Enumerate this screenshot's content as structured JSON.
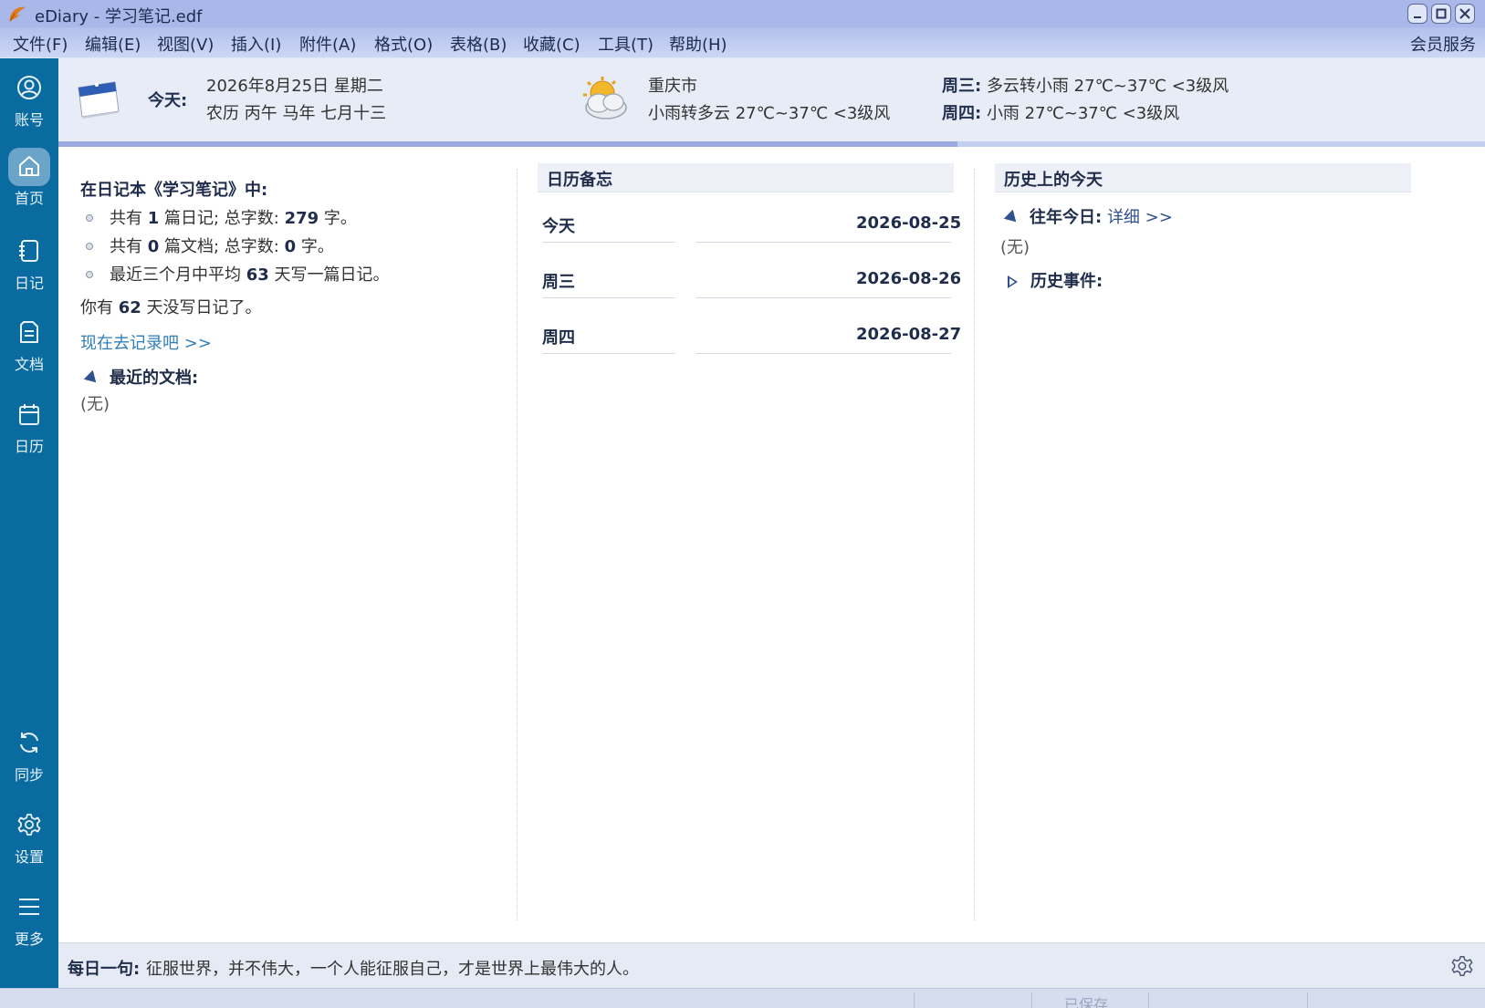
{
  "window": {
    "title": "eDiary - 学习笔记.edf",
    "member_service": "会员服务"
  },
  "menu": [
    "文件(F)",
    "编辑(E)",
    "视图(V)",
    "插入(I)",
    "附件(A)",
    "格式(O)",
    "表格(B)",
    "收藏(C)",
    "工具(T)",
    "帮助(H)"
  ],
  "sidebar": {
    "items": [
      {
        "label": "账号",
        "icon": "account-icon"
      },
      {
        "label": "首页",
        "icon": "home-icon",
        "active": true
      },
      {
        "label": "日记",
        "icon": "diary-icon"
      },
      {
        "label": "文档",
        "icon": "document-icon"
      },
      {
        "label": "日历",
        "icon": "calendar-icon"
      },
      {
        "label": "同步",
        "icon": "sync-icon"
      },
      {
        "label": "设置",
        "icon": "settings-icon"
      },
      {
        "label": "更多",
        "icon": "more-icon"
      }
    ]
  },
  "header": {
    "today_label": "今天:",
    "date": "2026年8月25日 星期二",
    "lunar": "农历 丙午 马年 七月十三",
    "city": "重庆市",
    "weather_today": "小雨转多云 27℃~37℃ <3级风",
    "forecast": [
      {
        "day": "周三:",
        "desc": "多云转小雨 27℃~37℃ <3级风"
      },
      {
        "day": "周四:",
        "desc": "小雨 27℃~37℃ <3级风"
      }
    ],
    "progress": 0.63
  },
  "notebook": {
    "title": "在日记本《学习笔记》中:",
    "stats": [
      {
        "pre": "共有 ",
        "n1": "1",
        "mid": " 篇日记; 总字数: ",
        "n2": "279",
        "post": " 字。"
      },
      {
        "pre": "共有 ",
        "n1": "0",
        "mid": " 篇文档; 总字数: ",
        "n2": "0",
        "post": " 字。"
      },
      {
        "pre": "最近三个月中平均 ",
        "n1": "63",
        "mid": " 天写一篇日记。",
        "n2": "",
        "post": ""
      }
    ],
    "missed_pre": "你有 ",
    "missed_days": "62",
    "missed_post": " 天没写日记了。",
    "go_link": "现在去记录吧 >>",
    "recent_title": "最近的文档:",
    "recent_none": "(无)"
  },
  "memo": {
    "title": "日历备忘",
    "rows": [
      {
        "day": "今天",
        "date": "2026-08-25"
      },
      {
        "day": "周三",
        "date": "2026-08-26"
      },
      {
        "day": "周四",
        "date": "2026-08-27"
      }
    ]
  },
  "history": {
    "title": "历史上的今天",
    "past_label": "往年今日:",
    "past_link": "详细 >>",
    "past_none": "(无)",
    "events_label": "历史事件:"
  },
  "quote": {
    "label": "每日一句:",
    "text": "征服世界，并不伟大，一个人能征服自己，才是世界上最伟大的人。"
  },
  "status": {
    "saved": "已保存"
  }
}
